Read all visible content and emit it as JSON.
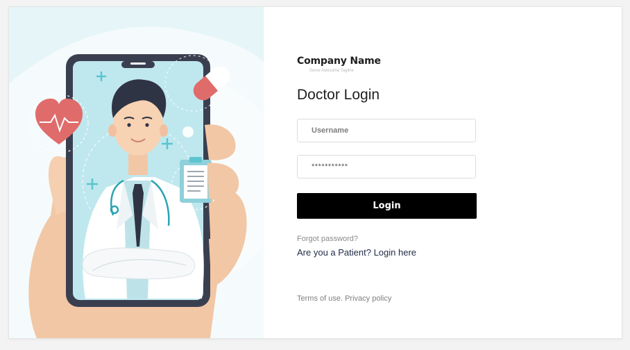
{
  "brand": {
    "name": "Company Name",
    "tagline": "Some Awesome Tagline"
  },
  "login": {
    "title": "Doctor Login",
    "username_placeholder": "Username",
    "password_value": "***********",
    "button_label": "Login",
    "forgot_password": "Forgot password?",
    "patient_login": "Are you a Patient? Login here"
  },
  "footer": {
    "terms": "Terms of use.",
    "privacy": "Privacy policy"
  },
  "illustration": {
    "subject": "doctor-on-phone-illustration",
    "icons": [
      "heart-icon",
      "medical-cross-icon",
      "pill-icon",
      "clipboard-icon",
      "stethoscope-icon"
    ]
  },
  "colors": {
    "panel_bg": "#e6f5f8",
    "button_bg": "#000000",
    "button_text": "#ffffff",
    "heart": "#e06b6b",
    "teal": "#5bc4cf"
  }
}
